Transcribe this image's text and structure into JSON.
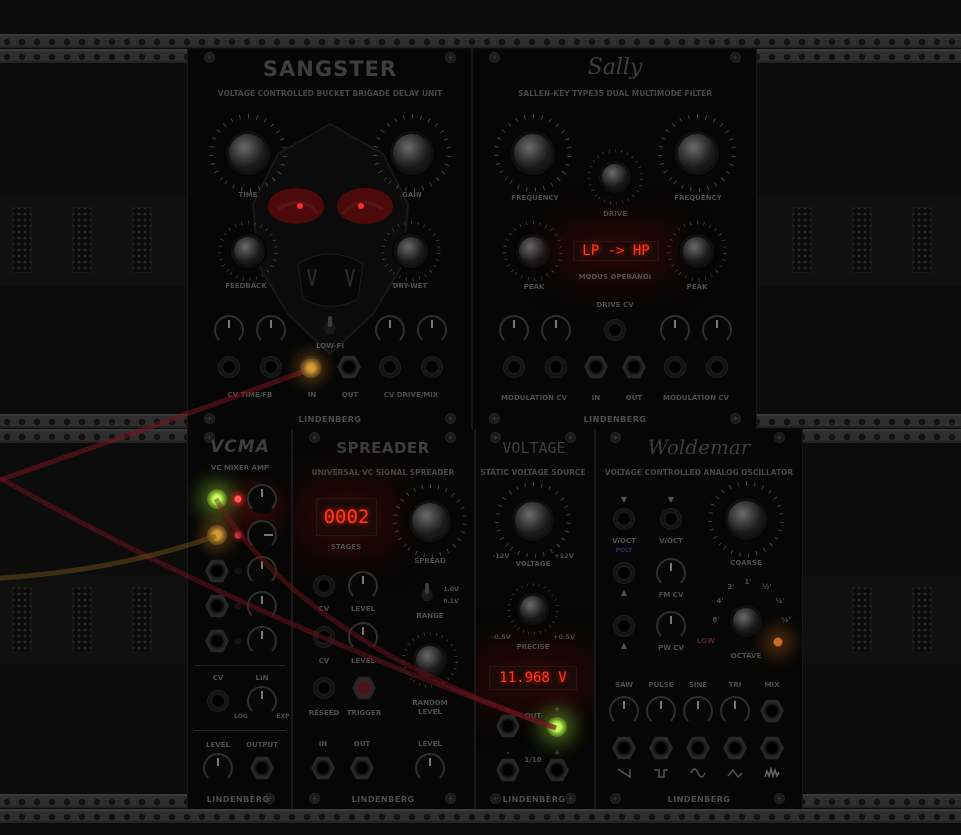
{
  "rack": {
    "brand": "LINDENBERG"
  },
  "sangster": {
    "title": "SANGSTER",
    "subtitle": "VOLTAGE CONTROLLED BUCKET BRIGADE DELAY UNIT",
    "knobs": {
      "time": "TIME",
      "gain": "GAIN",
      "feedback": "FEEDBACK",
      "dry_wet": "DRY-WET"
    },
    "toggle": "LOW-FI",
    "jacks": {
      "cv_time_fb": "CV TIME/FB",
      "in": "IN",
      "out": "OUT",
      "cv_drive_mix": "CV DRIVE/MIX"
    },
    "brand": "LINDENBERG"
  },
  "sally": {
    "title": "Sally",
    "subtitle": "SALLEN-KEY TYPE35 DUAL MULTIMODE FILTER",
    "knobs": {
      "frequency_left": "FREQUENCY",
      "drive": "DRIVE",
      "frequency_right": "FREQUENCY",
      "peak_left": "PEAK",
      "peak_right": "PEAK"
    },
    "display": "LP -> HP",
    "display_label": "MODUS OPERANDI",
    "drive_cv": "DRIVE CV",
    "jacks": {
      "modulation_cv_left": "MODULATION CV",
      "in": "IN",
      "out": "OUT",
      "modulation_cv_right": "MODULATION CV"
    },
    "brand": "LINDENBERG"
  },
  "vcma": {
    "title": "VCMA",
    "subtitle": "VC MIXER AMP",
    "cv": "CV",
    "lin": "LIN",
    "log": "LOG",
    "exp": "EXP",
    "level": "LEVEL",
    "output": "OUTPUT",
    "brand": "LINDENBERG"
  },
  "spreader": {
    "title": "SPREADER",
    "subtitle": "UNIVERSAL VC SIGNAL SPREADER",
    "display": "0002",
    "stages": "STAGES",
    "spread": "SPREAD",
    "cv1": "CV",
    "level1": "LEVEL",
    "cv2": "CV",
    "level2": "LEVEL",
    "range": "RANGE",
    "range_hi": "1.0V",
    "range_lo": "0.1V",
    "reseed": "RESEED",
    "trigger": "TRIGGER",
    "random_level": "RANDOM LEVEL",
    "in": "IN",
    "out": "OUT",
    "level": "LEVEL",
    "brand": "LINDENBERG"
  },
  "voltage": {
    "title": "VOLTAGE",
    "subtitle": "STATIC VOLTAGE SOURCE",
    "voltage_min": "-12V",
    "voltage_max": "+12V",
    "voltage_label": "VOLTAGE",
    "precise_min": "-0.5V",
    "precise_max": "+0.5V",
    "precise_label": "PRECISE",
    "display": "11.968 V",
    "out": "OUT",
    "minus": "-",
    "plus": "+",
    "tenth": "1/10",
    "brand": "LINDENBERG"
  },
  "woldemar": {
    "title": "Woldemar",
    "subtitle": "VOLTAGE CONTROLLED ANALOG OSCILLATOR",
    "voct1": "V/OCT",
    "poly": "POLY",
    "voct2": "V/OCT",
    "coarse": "COARSE",
    "fm_cv": "FM CV",
    "pw_cv": "PW CV",
    "octave": "OCTAVE",
    "low": "LOW",
    "octave_steps": [
      "8'",
      "4'",
      "2'",
      "1'",
      "½'",
      "¼'",
      "⅛'"
    ],
    "outs": [
      "SAW",
      "PULSE",
      "SINE",
      "TRI",
      "MIX"
    ],
    "brand": "LINDENBERG"
  }
}
